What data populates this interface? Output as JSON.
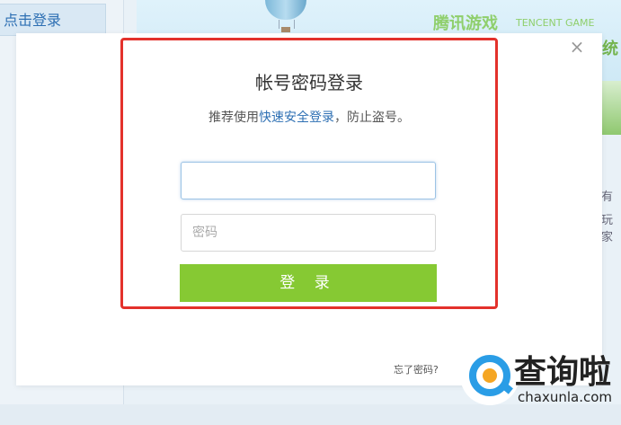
{
  "background": {
    "login_tab": "点击登录",
    "brand_cn": "腾讯游戏",
    "brand_en": "TENCENT GAME",
    "side_text_top": "统",
    "side_text_1": "有",
    "side_text_2": "玩家"
  },
  "modal": {
    "close_symbol": "×",
    "title": "帐号密码登录",
    "subtitle_prefix": "推荐使用",
    "subtitle_link": "快速安全登录",
    "subtitle_suffix": "，防止盗号。",
    "account_value": "",
    "account_placeholder": "",
    "password_placeholder": "密码",
    "login_button": "登 录",
    "forgot_password": "忘了密码?"
  },
  "watermark": {
    "cn": "查询啦",
    "en": "chaxunla.com"
  },
  "colors": {
    "accent_green": "#86c933",
    "link_blue": "#2d6fb3",
    "highlight_red": "#e3312b"
  }
}
